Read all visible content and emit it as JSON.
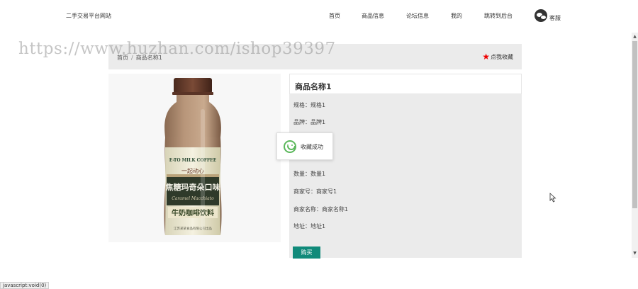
{
  "header": {
    "site_name": "二手交易平台网站",
    "nav": [
      "首页",
      "商品信息",
      "论坛信息",
      "我的",
      "跳转到后台"
    ],
    "service_label": "客服"
  },
  "watermark": "https://www.huzhan.com/ishop39397",
  "breadcrumb": {
    "items": [
      "首页",
      "商品名称1"
    ],
    "separator": "/",
    "favorite_label": "点我收藏"
  },
  "product": {
    "title": "商品名称1",
    "image_text": {
      "brand_top": "E-TO MILK COFFEE",
      "slogan": "一起动心",
      "flavor": "焦糖玛奇朵口味",
      "flavor_en": "Caramel Macchiato",
      "product_type": "牛奶咖啡饮料",
      "footer": "江苏某某食品有限公司出品"
    },
    "fields": [
      {
        "label": "规格",
        "value": "规格1"
      },
      {
        "label": "品牌",
        "value": "品牌1"
      },
      {
        "label": "数量",
        "value": "数量1"
      },
      {
        "label": "商家号",
        "value": "商家号1"
      },
      {
        "label": "商家名称",
        "value": "商家名称1"
      },
      {
        "label": "地址",
        "value": "地址1"
      }
    ],
    "field_separator": "：",
    "buy_label": "购买"
  },
  "toast": {
    "message": "收藏成功"
  },
  "status_bar": "javascript:void(0)",
  "colors": {
    "accent": "#108a7a",
    "favorite_star": "#e00000",
    "toast_icon": "#5cb85c",
    "panel_bg": "#ebebeb"
  }
}
